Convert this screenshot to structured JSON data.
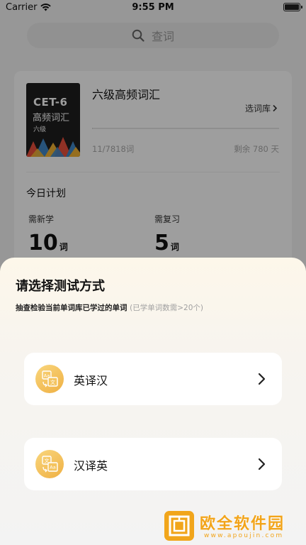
{
  "status_bar": {
    "carrier": "Carrier",
    "time": "9:55 PM"
  },
  "search": {
    "placeholder": "查词"
  },
  "book": {
    "cover_title": "CET-6",
    "cover_subtitle": "高频词汇",
    "cover_level": "六级",
    "name": "六级高频词汇",
    "switch_label": "选词库",
    "progress_text": "11/7818词",
    "progress_fraction": 0.0014,
    "remaining_text": "剩余 780 天"
  },
  "plan": {
    "title": "今日计划",
    "new_label": "需新学",
    "new_count": "10",
    "review_label": "需复习",
    "review_count": "5",
    "unit": "词"
  },
  "sheet": {
    "title": "请选择测试方式",
    "subtitle": "抽查检验当前单词库已学过的单词",
    "hint": "(已学单词数需>20个)",
    "options": [
      {
        "label": "英译汉",
        "icon": "translate-en-zh-icon"
      },
      {
        "label": "汉译英",
        "icon": "translate-zh-en-icon"
      }
    ]
  },
  "watermark": {
    "text": "欧全软件园",
    "url": "www.apoujin.com"
  },
  "colors": {
    "accent": "#f0b043",
    "overlay": "rgba(0,0,0,0.38)",
    "watermark": "#f2a41a"
  }
}
